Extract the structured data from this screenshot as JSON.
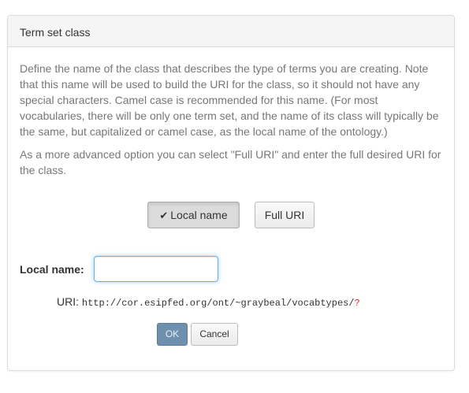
{
  "panel": {
    "title": "Term set class",
    "description": "Define the name of the class that describes the type of terms you are creating. Note that this name will be used to build the URI for the class, so it should not have any special characters. Camel case is recommended for this name. (For most vocabularies, there will be only one term set, and the name of its class will typically be the same, but capitalized or camel case, as the local name of the ontology.)",
    "advanced_note": "As a more advanced option you can select \"Full URI\" and enter the full desired URI for the class."
  },
  "mode_toggle": {
    "local_name_label": "Local name",
    "full_uri_label": "Full URI",
    "selected": "Local name",
    "check_glyph": "✔"
  },
  "form": {
    "local_name_label": "Local name:",
    "local_name_value": "",
    "uri_label": "URI:",
    "uri_value": "http://cor.esipfed.org/ont/~graybeal/vocabtypes/",
    "uri_placeholder_mark": "?"
  },
  "actions": {
    "ok_label": "OK",
    "cancel_label": "Cancel"
  },
  "colors": {
    "ok_button": "#6f8fae",
    "focus_border": "#66afe9",
    "uri_mark": "#d9302c"
  }
}
